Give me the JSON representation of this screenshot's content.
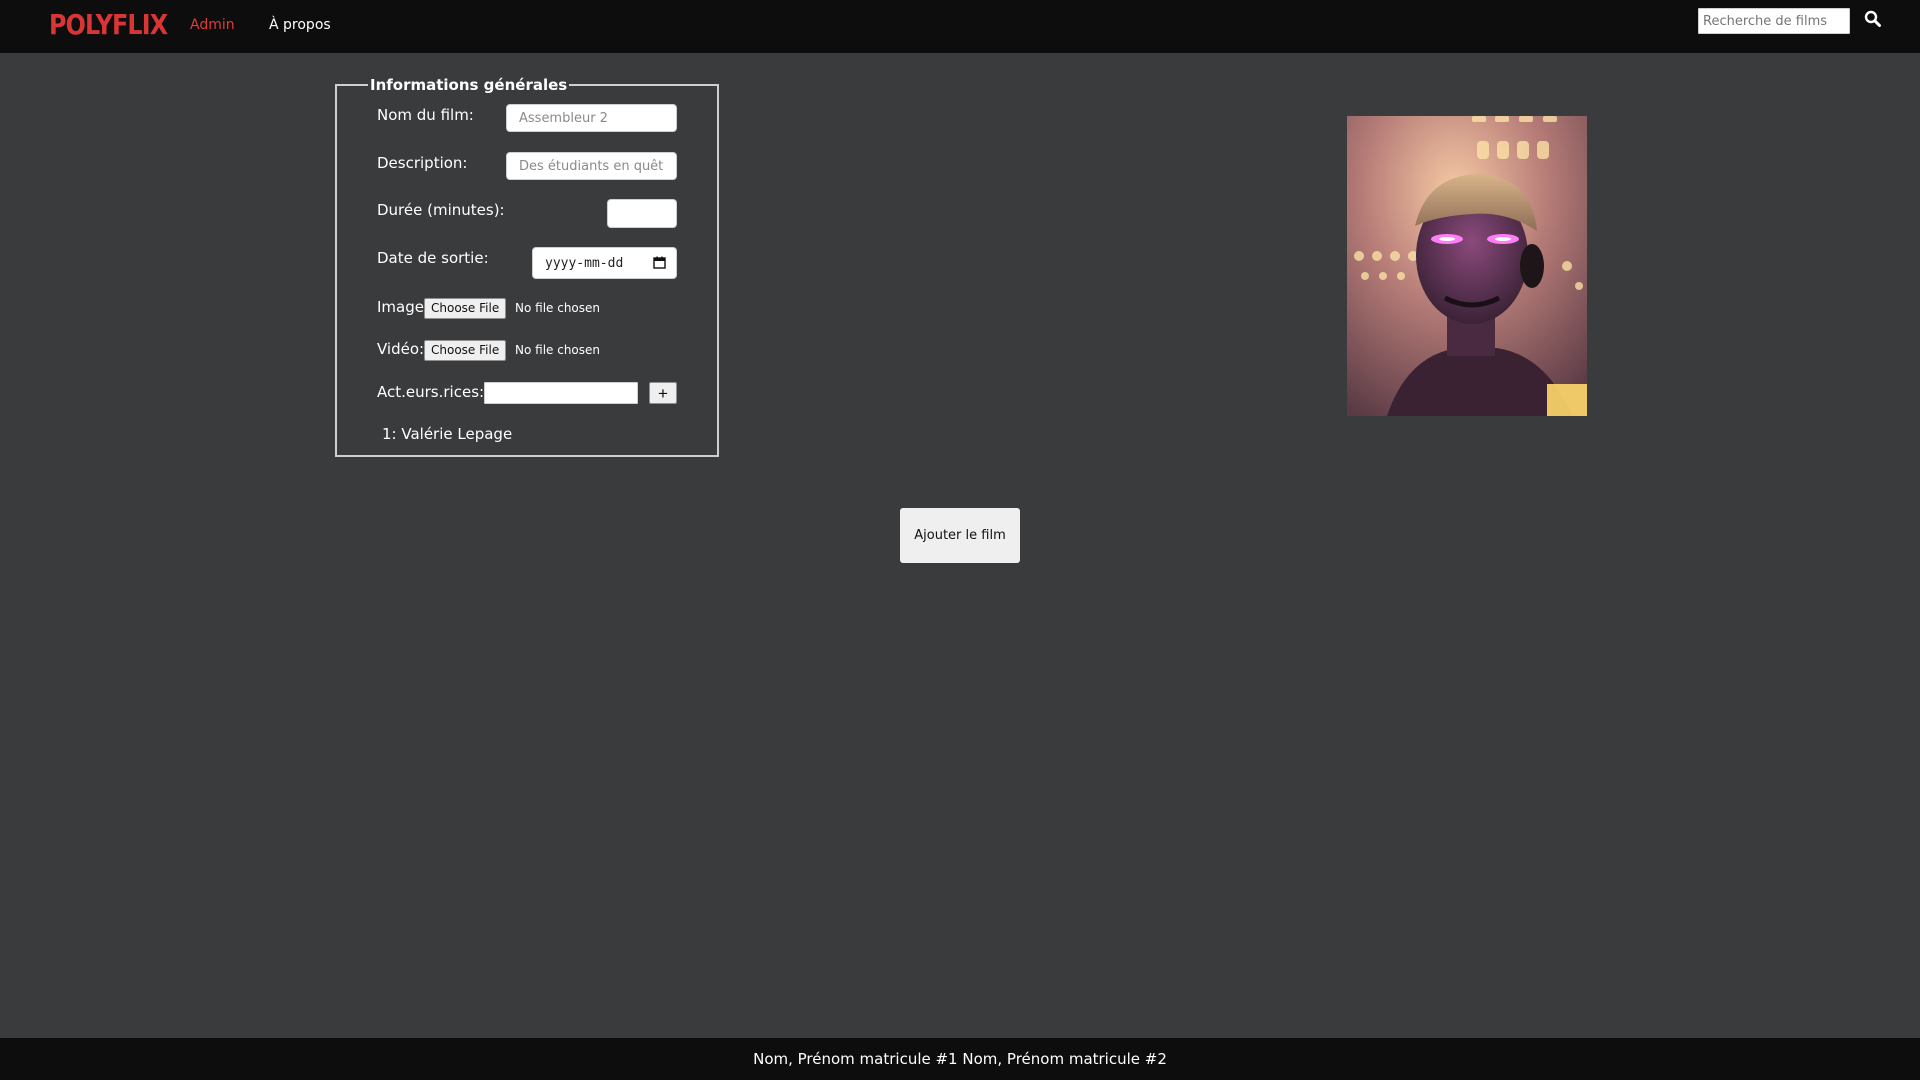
{
  "header": {
    "logo": "POLYFLIX",
    "nav": [
      {
        "label": "Admin",
        "active": true
      },
      {
        "label": "À propos",
        "active": false
      }
    ],
    "search": {
      "placeholder": "Recherche de films",
      "icon": "search-icon"
    }
  },
  "form": {
    "legend": "Informations générales",
    "fields": {
      "name": {
        "label": "Nom du film:",
        "placeholder": "Assembleur 2"
      },
      "description": {
        "label": "Description:",
        "placeholder": "Des étudiants en quête d"
      },
      "duration": {
        "label": "Durée (minutes):",
        "value": ""
      },
      "release_date": {
        "label": "Date de sortie:",
        "placeholder": "yyyy-mm-dd",
        "icon": "calendar-icon"
      },
      "image": {
        "label": "Image:",
        "button": "Choose File",
        "status": "No file chosen"
      },
      "video": {
        "label": "Vidéo:",
        "button": "Choose File",
        "status": "No file chosen"
      },
      "actors": {
        "label": "Act.eurs.rices:",
        "add_button": "+",
        "list": [
          "1: Valérie Lepage"
        ]
      }
    },
    "submit_label": "Ajouter le film"
  },
  "poster": {
    "alt": "Affiche du film"
  },
  "footer": {
    "text": "Nom, Prénom matricule #1 Nom, Prénom matricule #2"
  },
  "colors": {
    "background": "#3a3b3d",
    "navbar": "#0d0d0d",
    "brand": "#d93535",
    "active_link": "#e03a3a"
  }
}
